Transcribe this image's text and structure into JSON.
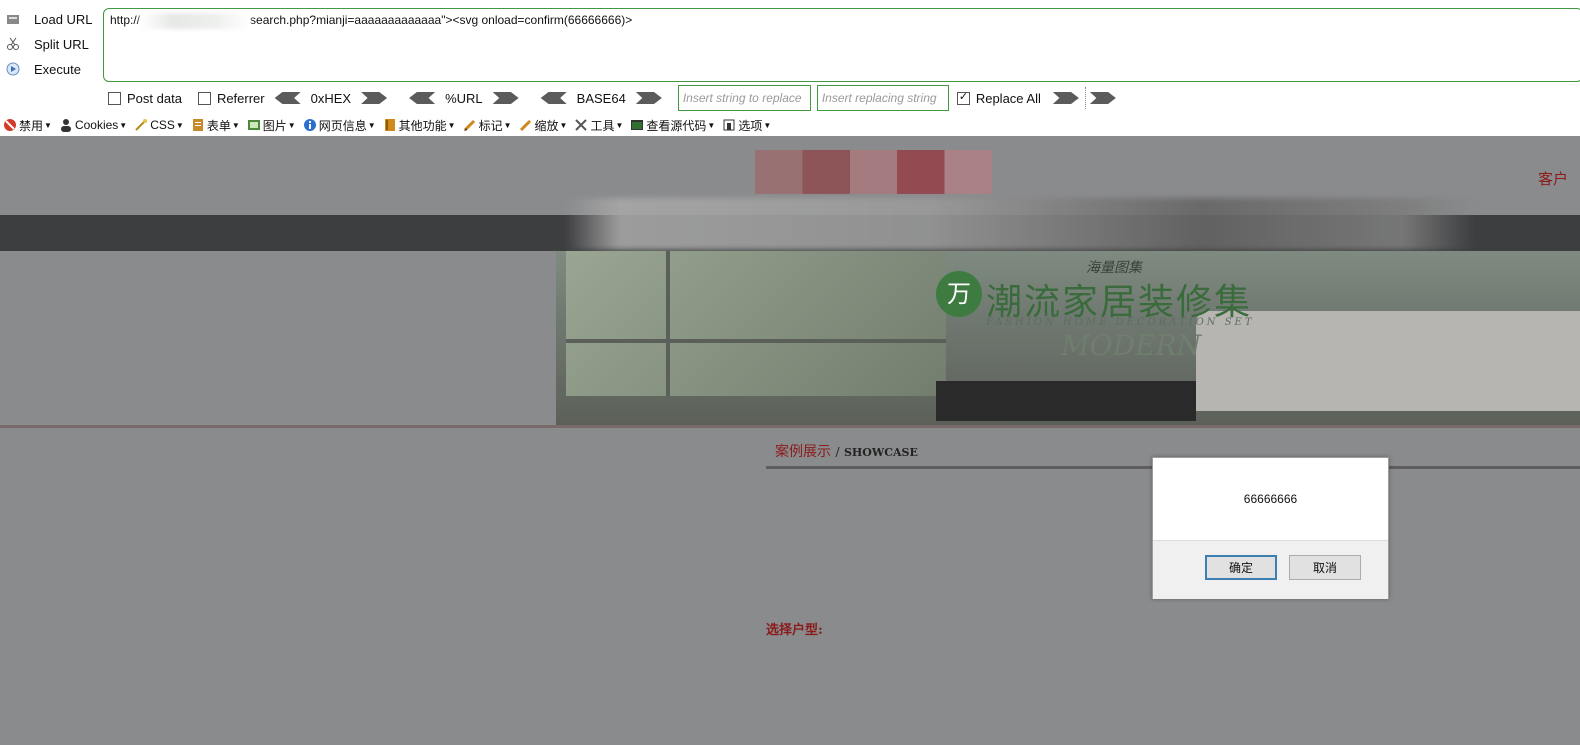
{
  "hackbar": {
    "commands": [
      {
        "label": "Load URL",
        "icon": "load-url-icon"
      },
      {
        "label": "Split URL",
        "icon": "split-url-icon"
      },
      {
        "label": "Execute",
        "icon": "execute-icon"
      }
    ],
    "url_prefix": "http://",
    "url_suffix": "search.php?mianji=aaaaaaaaaaaaa\"><svg onload=confirm(66666666)>",
    "post_data_label": "Post data",
    "referrer_label": "Referrer",
    "hex_label": "0xHEX",
    "url_enc_label": "%URL",
    "base64_label": "BASE64",
    "insert_replace_placeholder": "Insert string to replace",
    "insert_replacing_placeholder": "Insert replacing string",
    "replace_all_label": "Replace All",
    "replace_all_checked": true,
    "post_data_checked": false,
    "referrer_checked": false
  },
  "webdev_toolbar": {
    "items": [
      {
        "label": "禁用",
        "icon": "disable-icon"
      },
      {
        "label": "Cookies",
        "icon": "cookies-icon"
      },
      {
        "label": "CSS",
        "icon": "css-icon"
      },
      {
        "label": "表单",
        "icon": "forms-icon"
      },
      {
        "label": "图片",
        "icon": "images-icon"
      },
      {
        "label": "网页信息",
        "icon": "info-icon"
      },
      {
        "label": "其他功能",
        "icon": "misc-icon"
      },
      {
        "label": "标记",
        "icon": "outline-icon"
      },
      {
        "label": "缩放",
        "icon": "resize-icon"
      },
      {
        "label": "工具",
        "icon": "tools-icon"
      },
      {
        "label": "查看源代码",
        "icon": "view-source-icon"
      },
      {
        "label": "选项",
        "icon": "options-icon"
      }
    ]
  },
  "page": {
    "customer_text": "客户",
    "banner": {
      "top_text": "海量图集",
      "badge": "万",
      "title": "潮流家居装修集",
      "subtitle": "FASHION HOME DECORATION SET",
      "modern": "MODERN"
    },
    "section_title_cn": "案例展示",
    "section_sep": "/",
    "section_title_en": "SHOWCASE",
    "choose_label": "选择户型:"
  },
  "dialog": {
    "message": "66666666",
    "ok_label": "确定",
    "cancel_label": "取消"
  },
  "colors": {
    "accent_green": "#3f9a3f",
    "brand_red": "#8b1b1b",
    "overlay_gray": "#8a8b8d"
  }
}
